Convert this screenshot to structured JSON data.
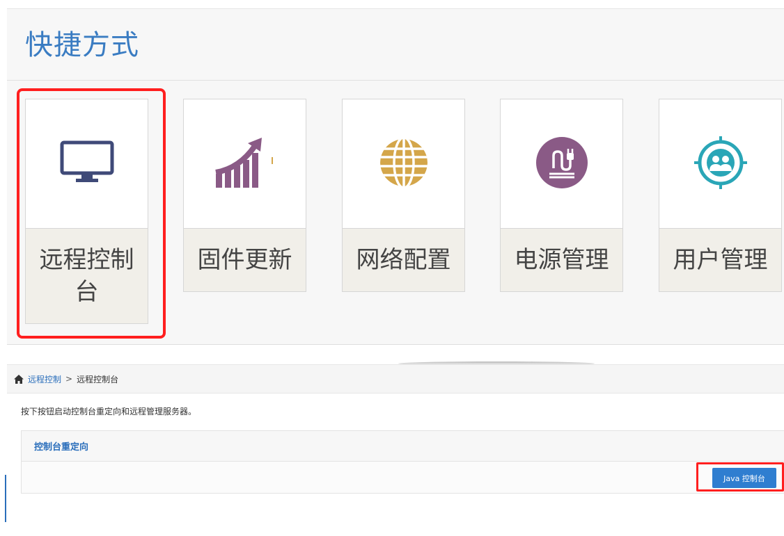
{
  "shortcuts": {
    "title": "快捷方式",
    "tiles": [
      {
        "label": "远程控制台",
        "icon": "monitor-icon",
        "color": "#3f4a78"
      },
      {
        "label": "固件更新",
        "icon": "growth-chart-icon",
        "color": "#8a5a86"
      },
      {
        "label": "网络配置",
        "icon": "globe-icon",
        "color": "#d4a64a"
      },
      {
        "label": "电源管理",
        "icon": "power-plug-icon",
        "color": "#8a5a86"
      },
      {
        "label": "用户管理",
        "icon": "users-icon",
        "color": "#2aa6b7"
      }
    ],
    "highlighted_tile": "远程控制台"
  },
  "breadcrumb": {
    "icon": "home-icon",
    "parent": "远程控制",
    "separator": ">",
    "current": "远程控制台"
  },
  "description": "按下按钮启动控制台重定向和远程管理服务器。",
  "panel": {
    "title": "控制台重定向",
    "button_label": "Java 控制台",
    "button_color": "#2f7ed0"
  },
  "colors": {
    "accent": "#3a7cc2",
    "link": "#2a6ebb",
    "highlight": "#ff1f1f"
  }
}
